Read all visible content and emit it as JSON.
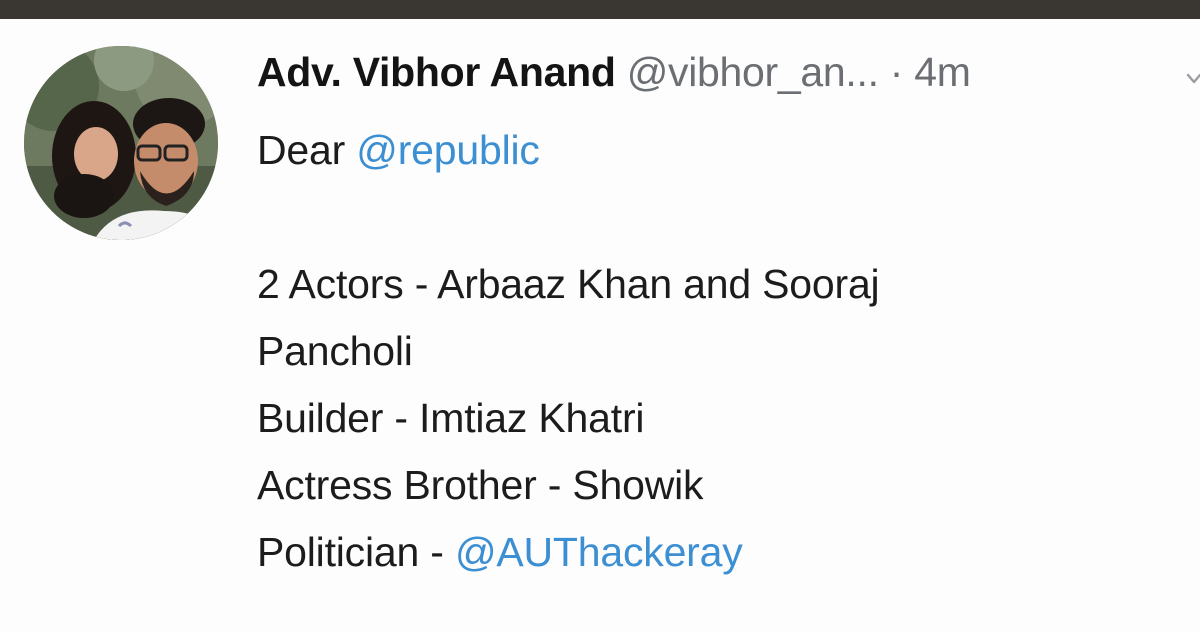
{
  "tweet": {
    "author_name": "Adv. Vibhor Anand",
    "author_handle": "@vibhor_an...",
    "separator": "·",
    "time_ago": "4m",
    "greeting_prefix": "Dear",
    "greeting_mention": "@republic",
    "lines": [
      "2 Actors - Arbaaz Khan and Sooraj",
      "Pancholi",
      "Builder - Imtiaz Khatri",
      "Actress Brother - Showik"
    ],
    "last_line_prefix": "Politician -",
    "last_line_mention": "@AUThackeray"
  },
  "colors": {
    "mention": "#3b8fd2",
    "secondary_text": "#6b6e72",
    "top_bar": "#3a3631"
  },
  "icons": {
    "menu": "chevron-down-icon"
  }
}
